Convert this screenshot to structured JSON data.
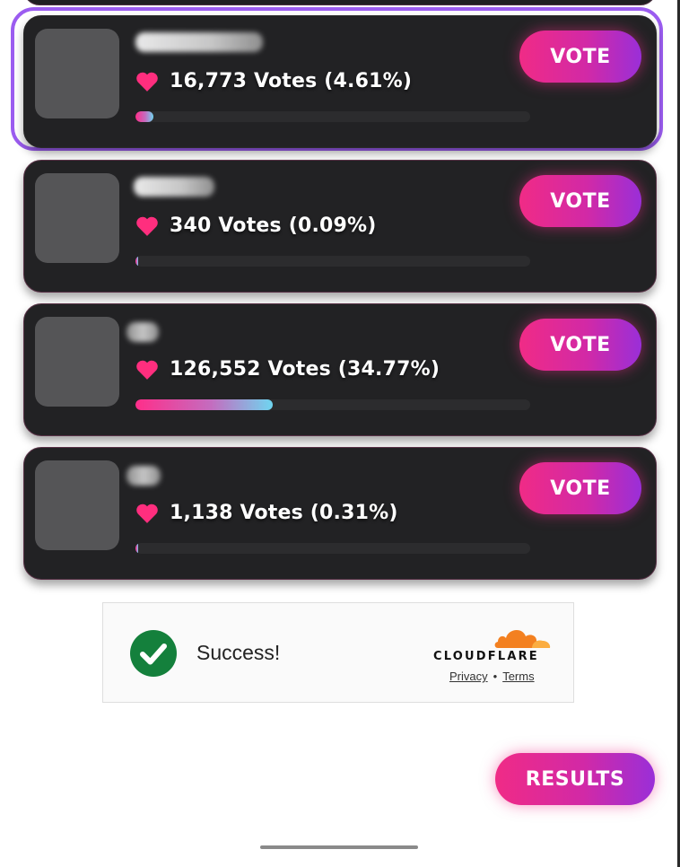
{
  "candidates": [
    {
      "votes_label": "16,773 Votes (4.61%)",
      "share": 0.0461,
      "selected": true
    },
    {
      "votes_label": "340 Votes (0.09%)",
      "share": 0.0009,
      "selected": false
    },
    {
      "votes_label": "126,552 Votes (34.77%)",
      "share": 0.3477,
      "selected": false
    },
    {
      "votes_label": "1,138 Votes (0.31%)",
      "share": 0.0031,
      "selected": false
    }
  ],
  "vote_label": "VOTE",
  "captcha": {
    "status_text": "Success!",
    "provider": "CLOUDFLARE",
    "privacy_label": "Privacy",
    "separator": "•",
    "terms_label": "Terms"
  },
  "results_label": "RESULTS",
  "colors": {
    "accent_pink": "#f02b86",
    "accent_purple": "#9a2fd8",
    "selected_ring": "#9b5cf0",
    "heart": "#ff2e7e",
    "card_bg": "#222224",
    "success_green": "#14803c",
    "cloudflare_orange": "#f38020"
  }
}
